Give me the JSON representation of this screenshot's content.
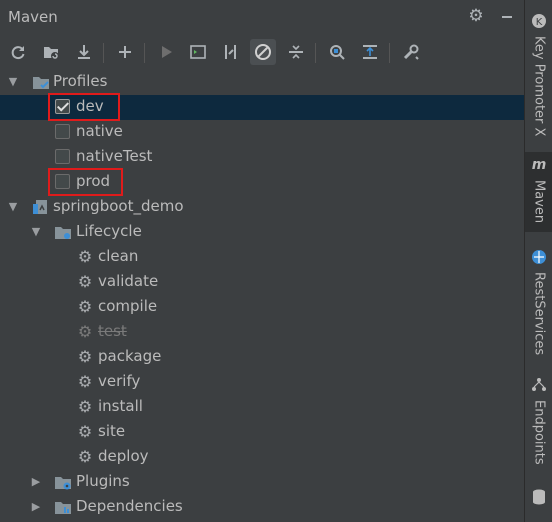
{
  "panel": {
    "title": "Maven"
  },
  "profiles": {
    "label": "Profiles",
    "items": [
      {
        "label": "dev",
        "checked": true
      },
      {
        "label": "native",
        "checked": false
      },
      {
        "label": "nativeTest",
        "checked": false
      },
      {
        "label": "prod",
        "checked": false
      }
    ]
  },
  "project": {
    "label": "springboot_demo",
    "lifecycle": {
      "label": "Lifecycle",
      "goals": [
        "clean",
        "validate",
        "compile",
        "test",
        "package",
        "verify",
        "install",
        "site",
        "deploy"
      ]
    },
    "plugins": "Plugins",
    "dependencies": "Dependencies"
  },
  "sidebar": {
    "items": [
      "Key Promoter X",
      "Maven",
      "RestServices",
      "Endpoints"
    ]
  },
  "colors": {
    "selection": "#0d293e",
    "highlight": "#e01b1b",
    "background": "#3c3f41"
  }
}
